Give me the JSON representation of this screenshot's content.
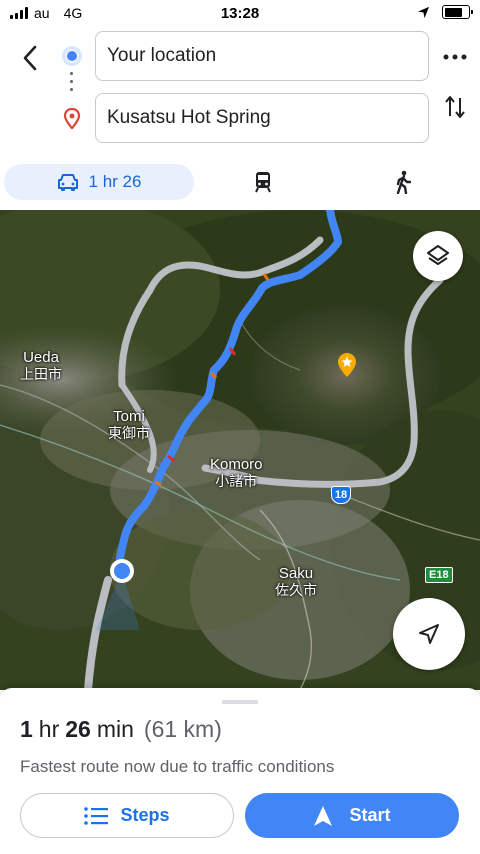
{
  "status": {
    "carrier": "au",
    "network": "4G",
    "time": "13:28",
    "battery_level": 0.75
  },
  "header": {
    "back_icon": "chevron-left-icon",
    "origin": {
      "value": "Your location"
    },
    "destination": {
      "value": "Kusatsu Hot Spring"
    },
    "more_icon": "more-horizontal-icon",
    "swap_icon": "swap-vertical-icon"
  },
  "modes": {
    "drive": {
      "icon": "car-icon",
      "label": "1 hr 26",
      "selected": true
    },
    "transit": {
      "icon": "train-icon"
    },
    "walk": {
      "icon": "walking-icon"
    }
  },
  "map": {
    "labels": {
      "ueda_en": "Ueda",
      "ueda_ja": "上田市",
      "tomi_en": "Tomi",
      "tomi_ja": "東御市",
      "komoro_en": "Komoro",
      "komoro_ja": "小諸市",
      "saku_en": "Saku",
      "saku_ja": "佐久市"
    },
    "route_shield": "18",
    "expressway_badge": "E18",
    "route_color": "#4285f4",
    "alt_route_color": "#b9bcc1"
  },
  "sheet": {
    "duration_hr_num": "1",
    "duration_hr_unit": "hr",
    "duration_min_num": "26",
    "duration_min_unit": "min",
    "distance": "(61 km)",
    "note": "Fastest route now due to traffic conditions",
    "steps_label": "Steps",
    "start_label": "Start"
  },
  "colors": {
    "accent": "#4285f4",
    "accent_text": "#1a73e8",
    "selected_tab_bg": "#e8f0fe"
  }
}
